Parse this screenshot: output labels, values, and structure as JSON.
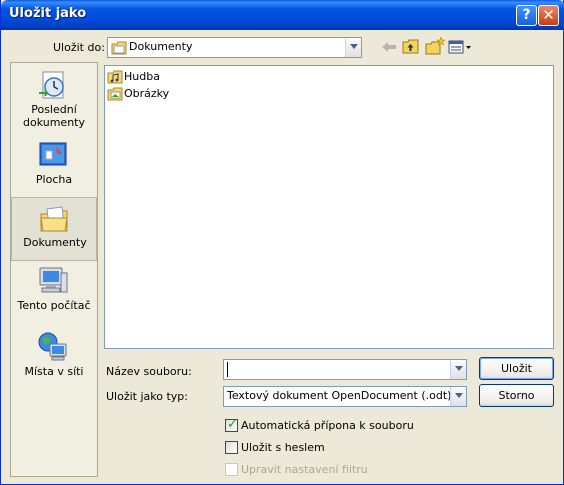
{
  "window": {
    "title": "Uložit jako"
  },
  "titlebar_buttons": {
    "help": "?",
    "close": "✕"
  },
  "save_in": {
    "label": "Uložit do:",
    "value": "Dokumenty"
  },
  "toolbar": {
    "back_icon": "back-arrow-icon",
    "up_icon": "up-folder-icon",
    "new_folder_icon": "new-folder-icon",
    "view_icon": "view-menu-icon"
  },
  "places": [
    {
      "label": "Poslední dokumenty",
      "icon": "recent-documents-icon"
    },
    {
      "label": "Plocha",
      "icon": "desktop-icon"
    },
    {
      "label": "Dokumenty",
      "icon": "my-documents-icon",
      "selected": true
    },
    {
      "label": "Tento počítač",
      "icon": "my-computer-icon"
    },
    {
      "label": "Místa v síti",
      "icon": "network-places-icon"
    }
  ],
  "files": [
    {
      "name": "Hudba",
      "icon": "music-folder-icon"
    },
    {
      "name": "Obrázky",
      "icon": "pictures-folder-icon"
    }
  ],
  "filename": {
    "label": "Název souboru:",
    "value": ""
  },
  "filetype": {
    "label": "Uložit jako typ:",
    "value": "Textový dokument OpenDocument (.odt)"
  },
  "buttons": {
    "save": "Uložit",
    "cancel": "Storno"
  },
  "options": {
    "auto_extension": {
      "label": "Automatická přípona k souboru",
      "checked": true
    },
    "save_with_password": {
      "label": "Uložit s heslem",
      "checked": false
    },
    "edit_filter": {
      "label": "Upravit nastavení filtru",
      "checked": false,
      "disabled": true
    }
  },
  "colors": {
    "titlebar": "#0055e5",
    "dialog": "#ece9d8",
    "checkmark": "#21a121"
  }
}
